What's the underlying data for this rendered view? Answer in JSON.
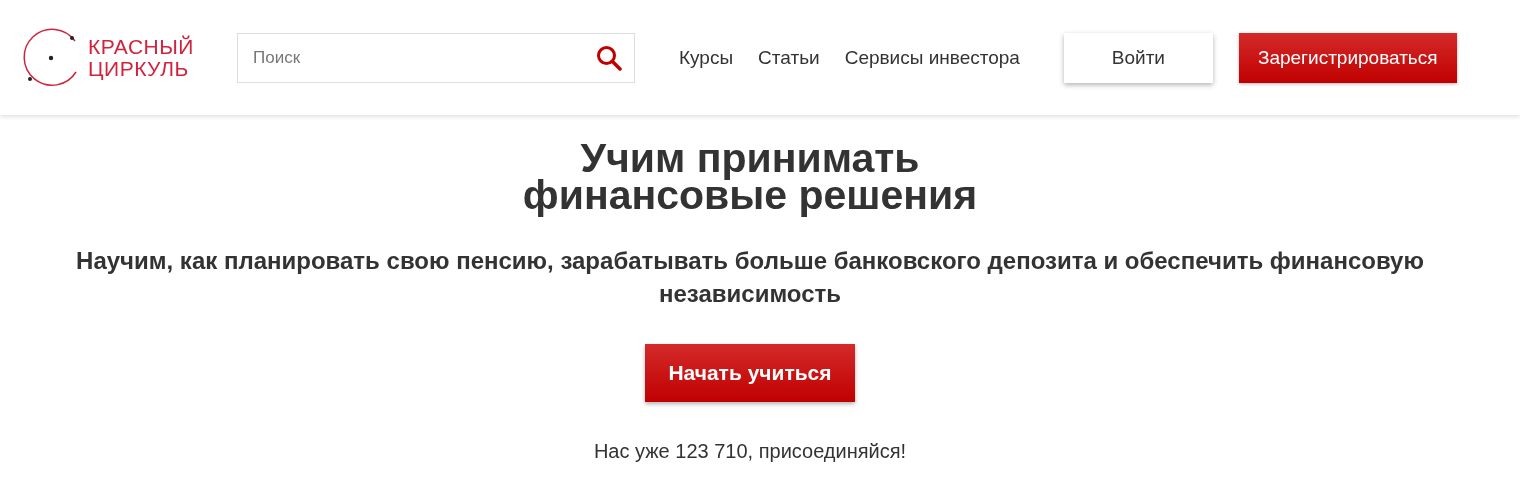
{
  "logo": {
    "line_1": "КРАСНЫЙ",
    "line_2": "ЦИРКУЛЬ"
  },
  "search": {
    "placeholder": "Поиск"
  },
  "nav": [
    "Курсы",
    "Статьи",
    "Сервисы инвестора"
  ],
  "buttons": [
    {
      "label": "Войти",
      "kind": "secondary"
    },
    {
      "label": "Зарегистрироваться",
      "kind": "primary"
    }
  ],
  "hero": {
    "title_lines": [
      "Учим принимать",
      "финансовые решения"
    ],
    "subtitle": "Научим, как планировать свою пенсию, зарабатывать больше банковского депозита и обеспечить финансовую независимость",
    "cta": "Начать учиться",
    "counter": "Нас уже 123 710, присоединяйся!"
  }
}
